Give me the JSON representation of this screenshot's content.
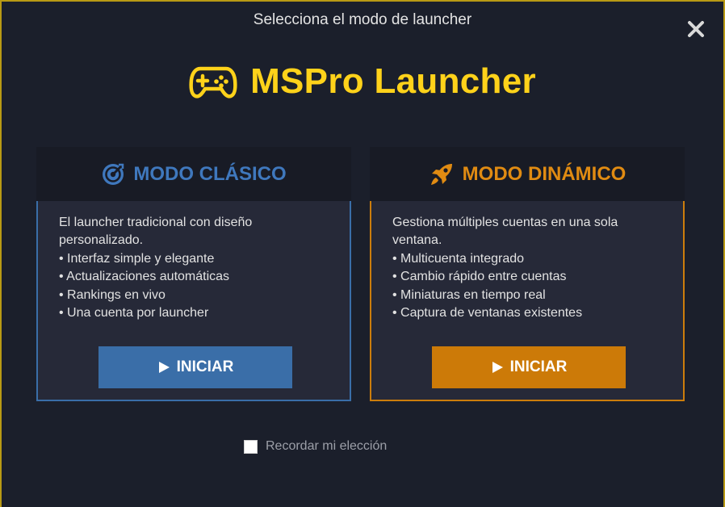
{
  "window": {
    "title": "Selecciona el modo de launcher",
    "close_icon": "close-icon"
  },
  "brand": {
    "icon": "gamepad-icon",
    "name": "MSPro Launcher",
    "color": "#ffd21a"
  },
  "modes": {
    "classic": {
      "icon": "target-icon",
      "title": "MODO CLÁSICO",
      "accent": "#3a6ea8",
      "description": [
        "El launcher tradicional con diseño",
        "personalizado.",
        "• Interfaz simple y elegante",
        "• Actualizaciones automáticas",
        "• Rankings en vivo",
        "• Una cuenta por launcher"
      ],
      "button_icon": "play-icon",
      "button_label": "INICIAR"
    },
    "dynamic": {
      "icon": "rocket-icon",
      "title": "MODO DINÁMICO",
      "accent": "#cc7a08",
      "description": [
        "Gestiona múltiples cuentas en una sola",
        "ventana.",
        "• Multicuenta integrado",
        "• Cambio rápido entre cuentas",
        "• Miniaturas en tiempo real",
        "• Captura de ventanas existentes"
      ],
      "button_icon": "play-icon",
      "button_label": "INICIAR"
    }
  },
  "remember": {
    "label": "Recordar mi elección",
    "checked": false
  }
}
